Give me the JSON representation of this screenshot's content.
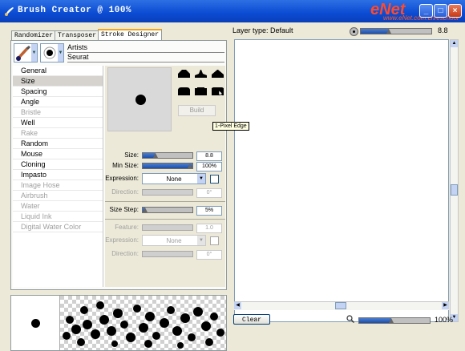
{
  "window": {
    "title": "Brush Creator @ 100%",
    "watermark": "eNet",
    "watermark_url": "www.eNet.com.cn/eschool",
    "buttons": [
      "minimize",
      "maximize",
      "close"
    ]
  },
  "tabs": [
    {
      "label": "Randomizer",
      "active": false
    },
    {
      "label": "Transposer",
      "active": false
    },
    {
      "label": "Stroke Designer",
      "active": true
    }
  ],
  "brush": {
    "category": "Artists",
    "variant": "Seurat"
  },
  "categories": [
    {
      "label": "General",
      "state": "normal"
    },
    {
      "label": "Size",
      "state": "selected"
    },
    {
      "label": "Spacing",
      "state": "normal"
    },
    {
      "label": "Angle",
      "state": "normal"
    },
    {
      "label": "Bristle",
      "state": "disabled"
    },
    {
      "label": "Well",
      "state": "normal"
    },
    {
      "label": "Rake",
      "state": "disabled"
    },
    {
      "label": "Random",
      "state": "normal"
    },
    {
      "label": "Mouse",
      "state": "normal"
    },
    {
      "label": "Cloning",
      "state": "normal"
    },
    {
      "label": "Impasto",
      "state": "normal"
    },
    {
      "label": "Image Hose",
      "state": "disabled"
    },
    {
      "label": "Airbrush",
      "state": "disabled"
    },
    {
      "label": "Water",
      "state": "disabled"
    },
    {
      "label": "Liquid Ink",
      "state": "disabled"
    },
    {
      "label": "Digital Water Color",
      "state": "disabled"
    }
  ],
  "size_panel": {
    "build_label": "Build",
    "tooltip": "1-Pixel Edge",
    "size": {
      "label": "Size:",
      "value": "8.8",
      "fraction": 0.25
    },
    "min_size": {
      "label": "Min Size:",
      "value": "100%",
      "fraction": 1.0
    },
    "expression": {
      "label": "Expression:",
      "value": "None"
    },
    "direction": {
      "label": "Direction:",
      "value": "0°"
    },
    "size_step": {
      "label": "Size Step:",
      "value": "5%",
      "fraction": 0.05
    },
    "feature": {
      "label": "Feature:",
      "value": "1.0"
    },
    "expression2": {
      "label": "Expression:",
      "value": "None"
    },
    "direction2": {
      "label": "Direction:",
      "value": "0°"
    }
  },
  "right": {
    "layer_type": "Layer type: Default",
    "zoom_top": "8.8",
    "zoom_top_fraction": 0.4,
    "clear_label": "Clear",
    "zoom_bottom": "100%",
    "zoom_bottom_fraction": 0.45
  },
  "colors": {
    "title_blue": "#0a4bd3",
    "slider_fill": "#1d4fa8",
    "tab_accent": "#f4a418"
  }
}
